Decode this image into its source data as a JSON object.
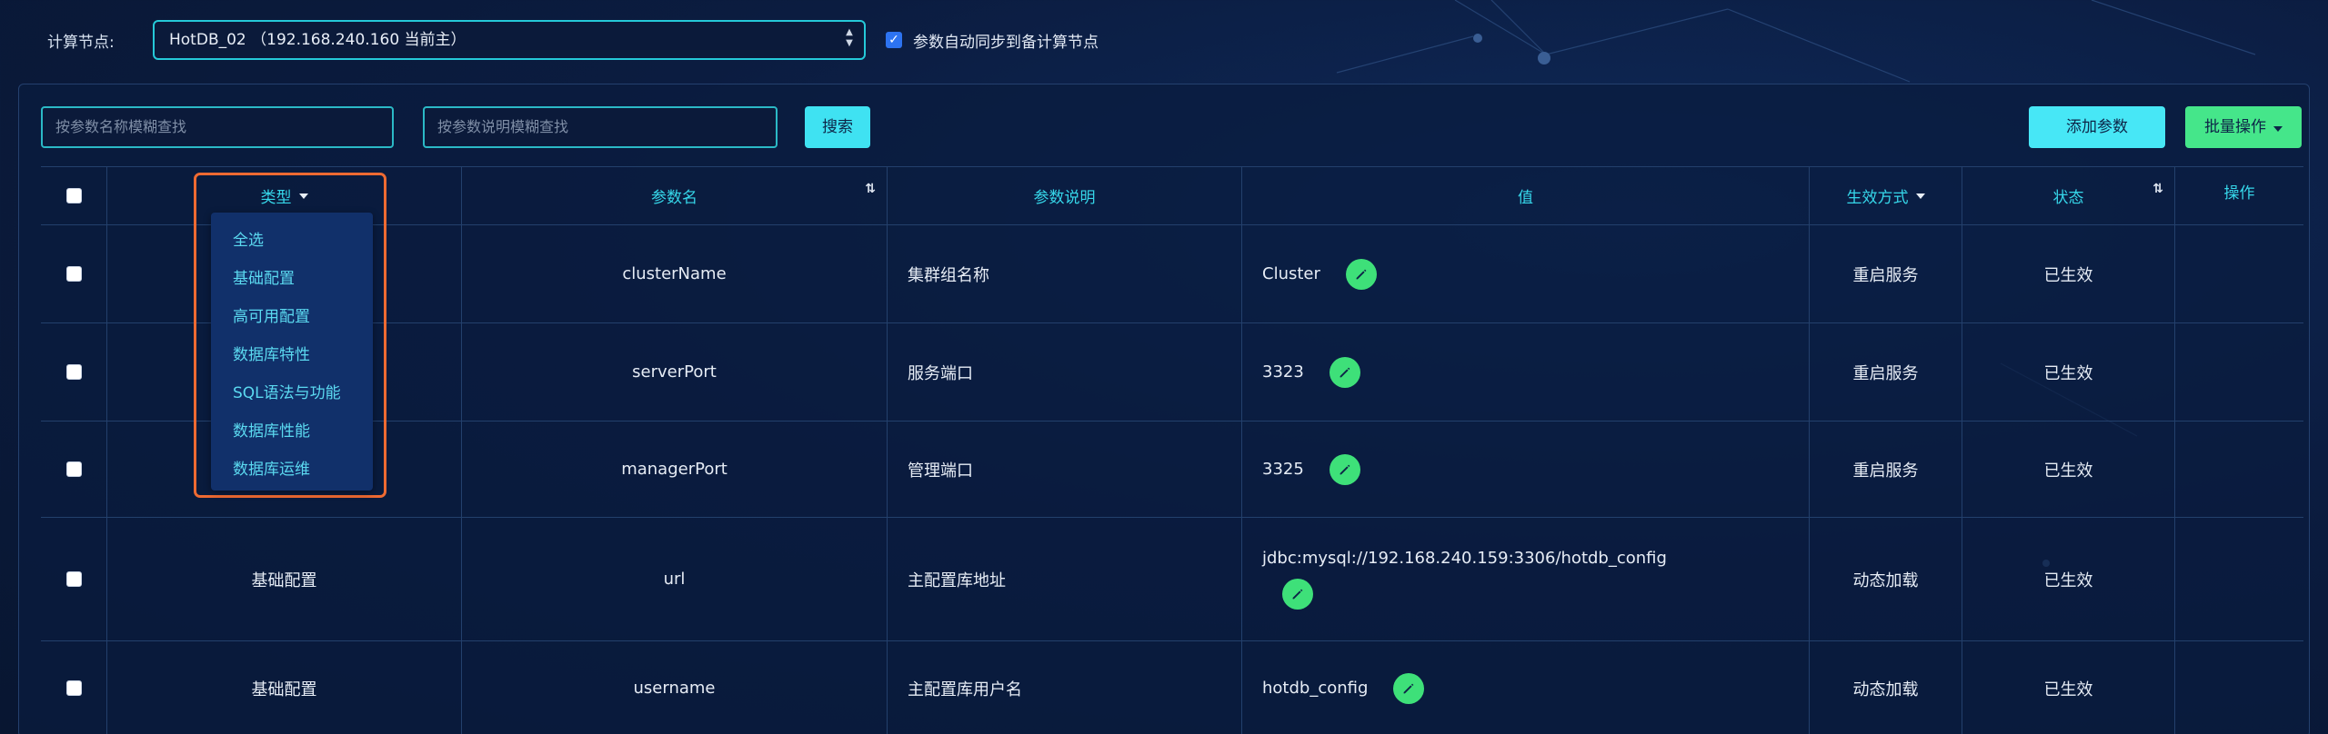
{
  "topbar": {
    "node_label": "计算节点:",
    "node_value": "HotDB_02 （192.168.240.160 当前主）",
    "sync_checked": true,
    "sync_label": "参数自动同步到备计算节点"
  },
  "toolbar": {
    "search_name_placeholder": "按参数名称模糊查找",
    "search_desc_placeholder": "按参数说明模糊查找",
    "search_button": "搜索",
    "add_button": "添加参数",
    "batch_button": "批量操作"
  },
  "table": {
    "headers": {
      "type": "类型",
      "name": "参数名",
      "description": "参数说明",
      "value": "值",
      "effect": "生效方式",
      "status": "状态",
      "action": "操作"
    },
    "rows": [
      {
        "type": "",
        "name": "clusterName",
        "description": "集群组名称",
        "value": "Cluster",
        "effect": "重启服务",
        "status": "已生效"
      },
      {
        "type": "",
        "name": "serverPort",
        "description": "服务端口",
        "value": "3323",
        "effect": "重启服务",
        "status": "已生效"
      },
      {
        "type": "",
        "name": "managerPort",
        "description": "管理端口",
        "value": "3325",
        "effect": "重启服务",
        "status": "已生效"
      },
      {
        "type": "基础配置",
        "name": "url",
        "description": "主配置库地址",
        "value": "jdbc:mysql://192.168.240.159:3306/hotdb_config",
        "effect": "动态加载",
        "status": "已生效"
      },
      {
        "type": "基础配置",
        "name": "username",
        "description": "主配置库用户名",
        "value": "hotdb_config",
        "effect": "动态加载",
        "status": "已生效"
      }
    ]
  },
  "type_dropdown": {
    "items": [
      "全选",
      "基础配置",
      "高可用配置",
      "数据库特性",
      "SQL语法与功能",
      "数据库性能",
      "数据库运维"
    ]
  },
  "colors": {
    "accent_cyan": "#36d7ea",
    "edit_green": "#3ee079",
    "highlight_orange": "#ee6a32"
  }
}
